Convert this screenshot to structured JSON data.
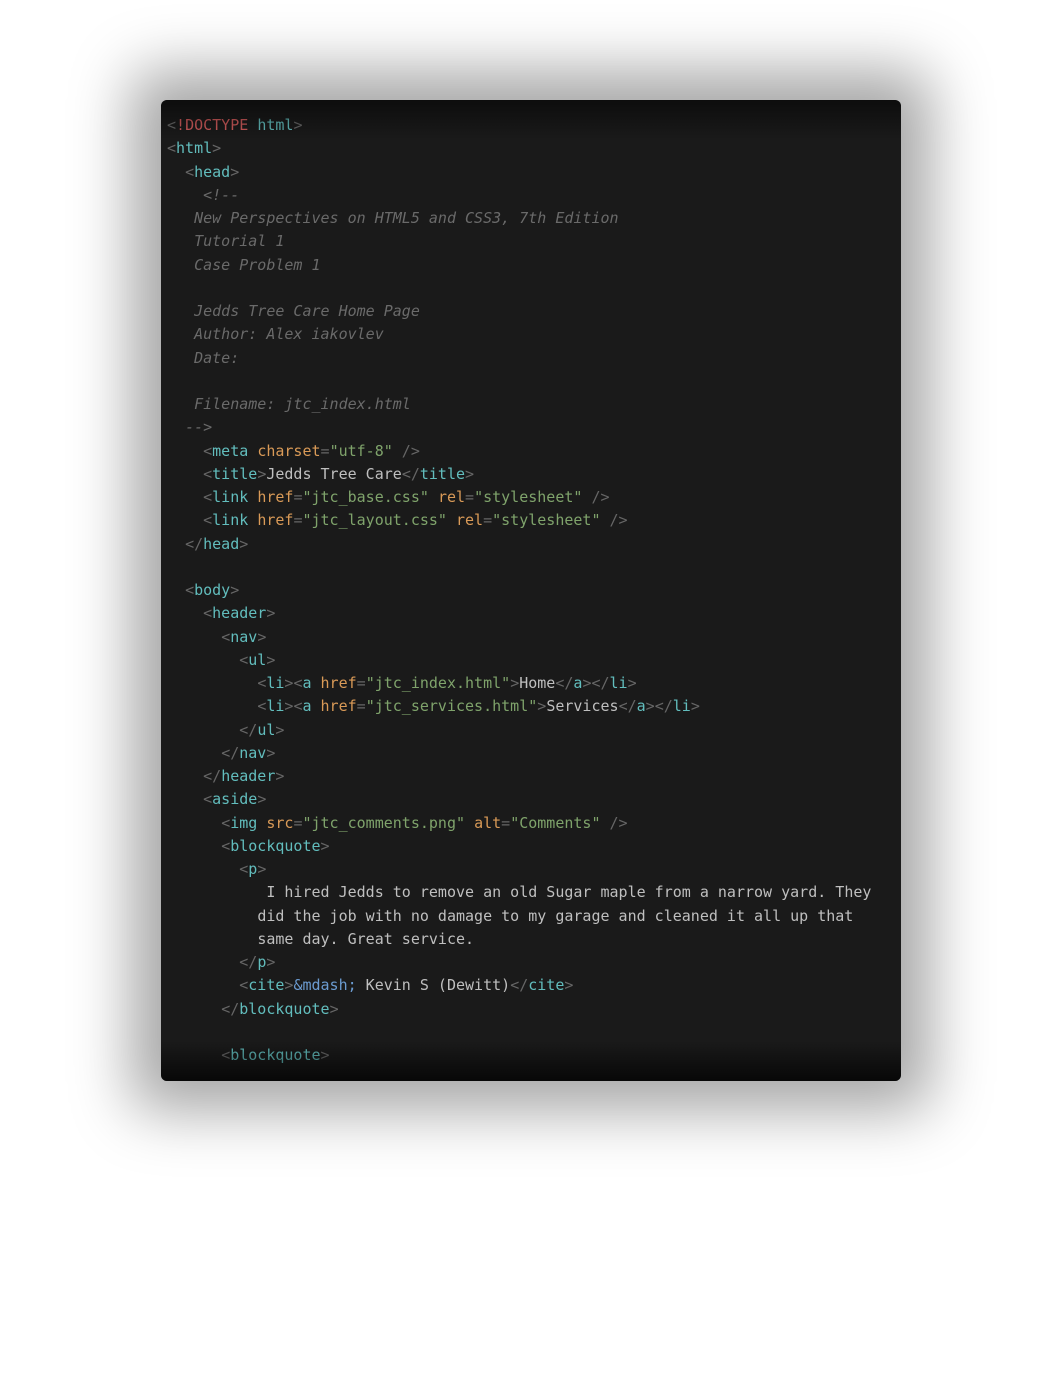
{
  "tokens": {
    "lt": "<",
    "gt": ">",
    "eq": "=",
    "slashgt": " />",
    "closeTagStart": "</",
    "bang": "!",
    "doctype": "DOCTYPE",
    "space": " "
  },
  "tags": {
    "html": "html",
    "head": "head",
    "meta": "meta",
    "title": "title",
    "link": "link",
    "body": "body",
    "header": "header",
    "nav": "nav",
    "ul": "ul",
    "li": "li",
    "a": "a",
    "aside": "aside",
    "img": "img",
    "blockquote": "blockquote",
    "p": "p",
    "cite": "cite"
  },
  "attrs": {
    "charset": "charset",
    "href": "href",
    "rel": "rel",
    "src": "src",
    "alt": "alt"
  },
  "values": {
    "utf8": "\"utf-8\"",
    "titleText": "Jedds Tree Care",
    "baseCss": "\"jtc_base.css\"",
    "layoutCss": "\"jtc_layout.css\"",
    "stylesheet": "\"stylesheet\"",
    "indexHtml": "\"jtc_index.html\"",
    "servicesHtml": "\"jtc_services.html\"",
    "commentsPng": "\"jtc_comments.png\"",
    "altComments": "\"Comments\"",
    "navHome": "Home",
    "navServices": "Services",
    "mdash": "&mdash;",
    "citeText": " Kevin S (Dewitt)"
  },
  "comment": {
    "open": "<!--",
    "l1": "   New Perspectives on HTML5 and CSS3, 7th Edition",
    "l2": "   Tutorial 1",
    "l3": "   Case Problem 1",
    "l4": "",
    "l5": "   Jedds Tree Care Home Page",
    "l6": "   Author: Alex iakovlev",
    "l7": "   Date:",
    "l8": "",
    "l9": "   Filename: jtc_index.html",
    "close": "  -->"
  },
  "paragraph": {
    "l1": "           I hired Jedds to remove an old Sugar maple from a narrow yard. They",
    "l2": "          did the job with no damage to my garage and cleaned it all up that",
    "l3": "          same day. Great service."
  }
}
